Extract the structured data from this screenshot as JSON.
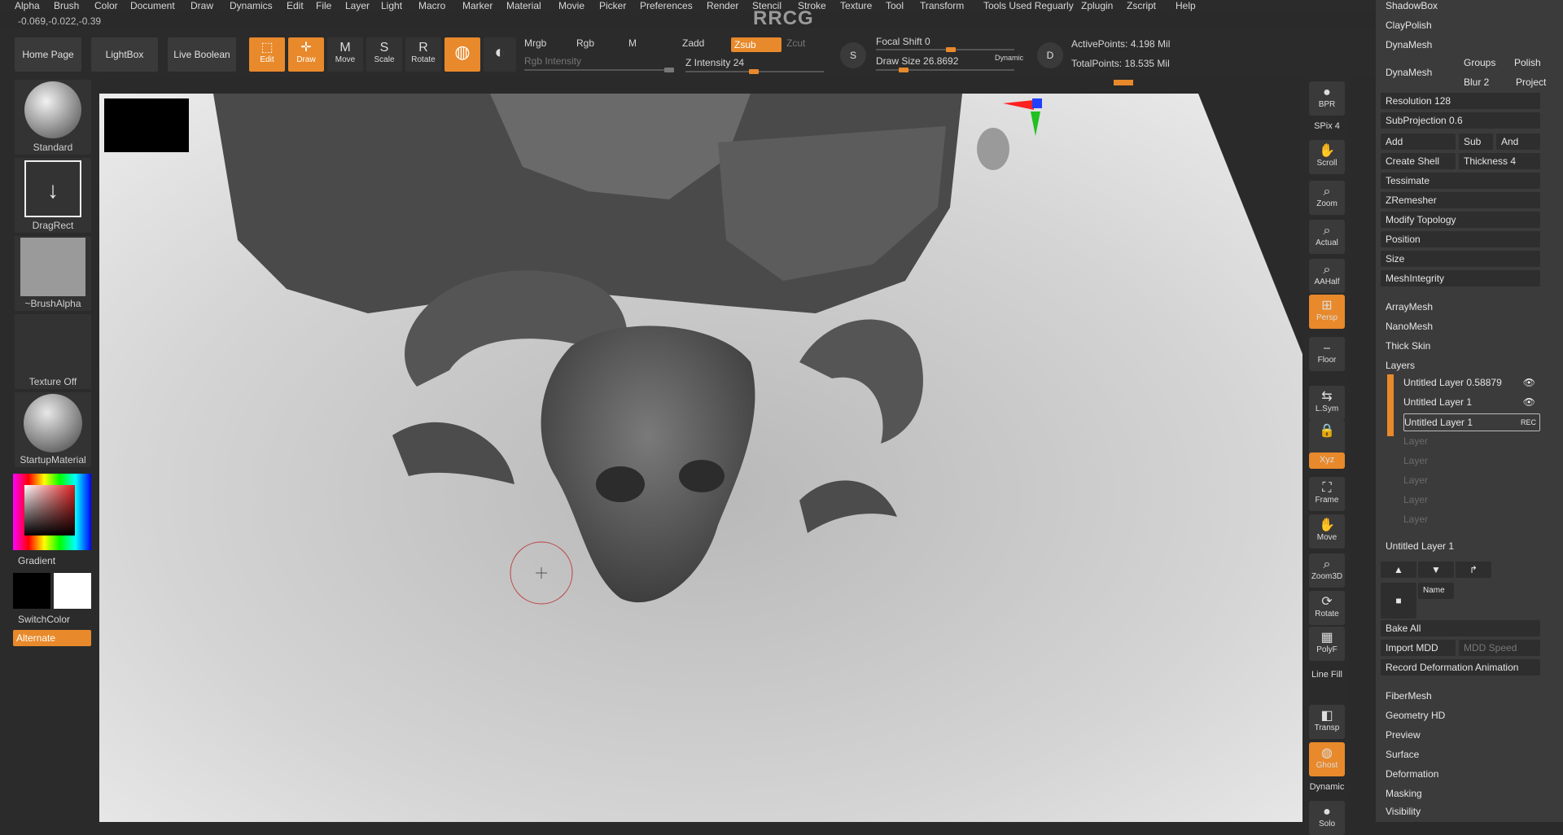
{
  "menu": [
    "Alpha",
    "Brush",
    "Color",
    "Document",
    "Draw",
    "Dynamics",
    "Edit",
    "File",
    "Layer",
    "Light",
    "Macro",
    "Marker",
    "Material",
    "Movie",
    "Picker",
    "Preferences",
    "Render",
    "Stencil",
    "Stroke",
    "Texture",
    "Tool",
    "Transform",
    "Tools Used Reguarly",
    "Zplugin",
    "Zscript",
    "Help"
  ],
  "coords": "-0.069,-0.022,-0.39",
  "watermark_title": "RRCG",
  "toolbar": {
    "home": "Home Page",
    "lightbox": "LightBox",
    "live_boolean": "Live Boolean",
    "edit": "Edit",
    "draw": "Draw",
    "move": "Move",
    "scale": "Scale",
    "rotate": "Rotate",
    "mrgb": "Mrgb",
    "rgb": "Rgb",
    "m": "M",
    "rgb_intensity": "Rgb Intensity",
    "zadd": "Zadd",
    "zsub": "Zsub",
    "zcut": "Zcut",
    "z_intensity": "Z Intensity 24",
    "focal_shift": "Focal Shift 0",
    "draw_size": "Draw Size 26.8692",
    "dynamic": "Dynamic",
    "active_points": "ActivePoints: 4.198 Mil",
    "total_points": "TotalPoints: 18.535 Mil",
    "s": "S",
    "d": "D"
  },
  "leftshelf": {
    "brush": "Standard",
    "stroke": "DragRect",
    "alpha": "~BrushAlpha",
    "texture": "Texture Off",
    "material": "StartupMaterial",
    "gradient": "Gradient",
    "switchcolor": "SwitchColor",
    "alternate": "Alternate"
  },
  "rightshelf": [
    {
      "name": "bpr",
      "label": "BPR"
    },
    {
      "name": "spix",
      "label": "SPix 4"
    },
    {
      "name": "scroll",
      "label": "Scroll"
    },
    {
      "name": "zoom",
      "label": "Zoom"
    },
    {
      "name": "actual",
      "label": "Actual"
    },
    {
      "name": "aahalf",
      "label": "AAHalf"
    },
    {
      "name": "persp",
      "label": "Persp"
    },
    {
      "name": "floor",
      "label": "Floor"
    },
    {
      "name": "lsym",
      "label": "L.Sym"
    },
    {
      "name": "lock",
      "label": ""
    },
    {
      "name": "xyz",
      "label": "Xyz"
    },
    {
      "name": "frame",
      "label": "Frame"
    },
    {
      "name": "move",
      "label": "Move"
    },
    {
      "name": "zoom3d",
      "label": "Zoom3D"
    },
    {
      "name": "rotate",
      "label": "Rotate"
    },
    {
      "name": "polyf",
      "label": "PolyF"
    },
    {
      "name": "linefill",
      "label": "Line Fill"
    },
    {
      "name": "transp",
      "label": "Transp"
    },
    {
      "name": "ghost",
      "label": "Ghost"
    },
    {
      "name": "dynamic",
      "label": "Dynamic"
    },
    {
      "name": "solo",
      "label": "Solo"
    }
  ],
  "panel": {
    "shadowbox": "ShadowBox",
    "claypolish": "ClayPolish",
    "dynamesh": "DynaMesh",
    "dynamesh_btn": "DynaMesh",
    "groups": "Groups",
    "polish": "Polish",
    "blur": "Blur 2",
    "project": "Project",
    "resolution": "Resolution 128",
    "subprojection": "SubProjection 0.6",
    "add": "Add",
    "sub": "Sub",
    "and": "And",
    "create_shell": "Create Shell",
    "thickness": "Thickness 4",
    "tessimate": "Tessimate",
    "zremesher": "ZRemesher",
    "modify_topology": "Modify Topology",
    "position": "Position",
    "size": "Size",
    "meshintegrity": "MeshIntegrity",
    "arraymesh": "ArrayMesh",
    "nanomesh": "NanoMesh",
    "thickskin": "Thick Skin",
    "layers": "Layers",
    "layer_list": [
      {
        "label": "Untitled Layer 0.58879",
        "active": true
      },
      {
        "label": "Untitled Layer 1",
        "active": true
      },
      {
        "label": "Untitled Layer 1",
        "active": true,
        "rec": "REC"
      },
      {
        "label": "Layer",
        "active": false
      },
      {
        "label": "Layer",
        "active": false
      },
      {
        "label": "Layer",
        "active": false
      },
      {
        "label": "Layer",
        "active": false
      },
      {
        "label": "Layer",
        "active": false
      }
    ],
    "current_layer": "Untitled Layer 1",
    "name": "Name",
    "bake_all": "Bake All",
    "import_mdd": "Import MDD",
    "mdd_speed": "MDD Speed",
    "record_anim": "Record Deformation Animation",
    "fibermesh": "FiberMesh",
    "geometry_hd": "Geometry HD",
    "preview": "Preview",
    "surface": "Surface",
    "deformation": "Deformation",
    "masking": "Masking",
    "visibility": "Visibility"
  },
  "colors": {
    "accent": "#e8892b",
    "panel": "#3b3b3b",
    "viewport": "#cfcfcf"
  }
}
